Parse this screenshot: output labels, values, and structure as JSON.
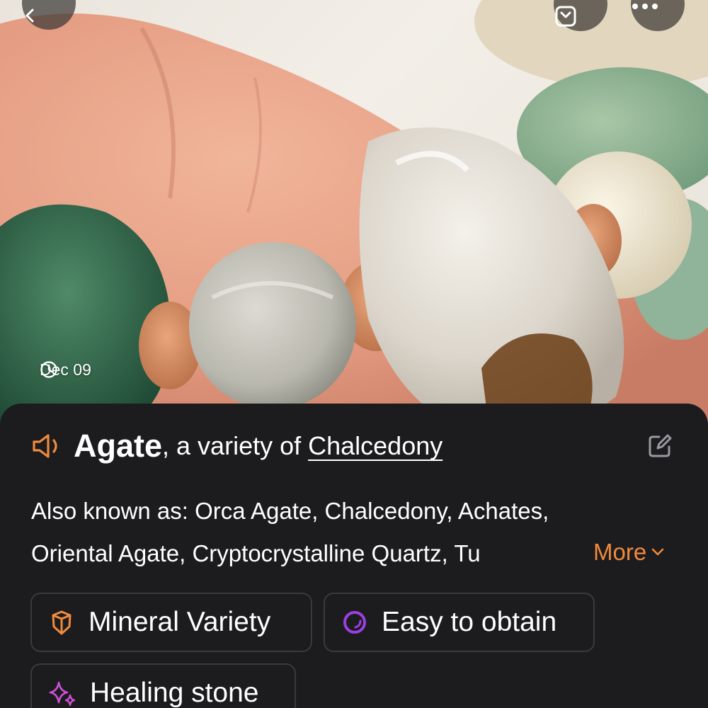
{
  "header": {
    "back_icon": "chevron-left-icon",
    "save_icon": "download-icon",
    "more_icon": "ellipsis-icon"
  },
  "photo": {
    "date": "Dec 09",
    "date_icon": "clock-icon"
  },
  "title": {
    "name": "Agate",
    "connector": ", a variety of ",
    "parent": "Chalcedony",
    "speaker_icon": "speaker-icon",
    "edit_icon": "edit-icon"
  },
  "aka": {
    "label": "Also known as: ",
    "line1": "Orca Agate, Chalcedony, Achates,",
    "line2": "Oriental Agate, Cryptocrystalline Quartz, Tu",
    "more_label": "More"
  },
  "tags": [
    {
      "label": "Mineral Variety",
      "icon": "gem-icon",
      "color": "#f08a3c"
    },
    {
      "label": "Easy to obtain",
      "icon": "ring-icon",
      "color": "#9b3fe0"
    },
    {
      "label": "Healing stone",
      "icon": "sparkle-icon",
      "color": "#d04fd8"
    }
  ],
  "colors": {
    "accent": "#f08a3c",
    "panel_bg": "#1c1c1e",
    "tag_border": "#3a3a3d"
  }
}
